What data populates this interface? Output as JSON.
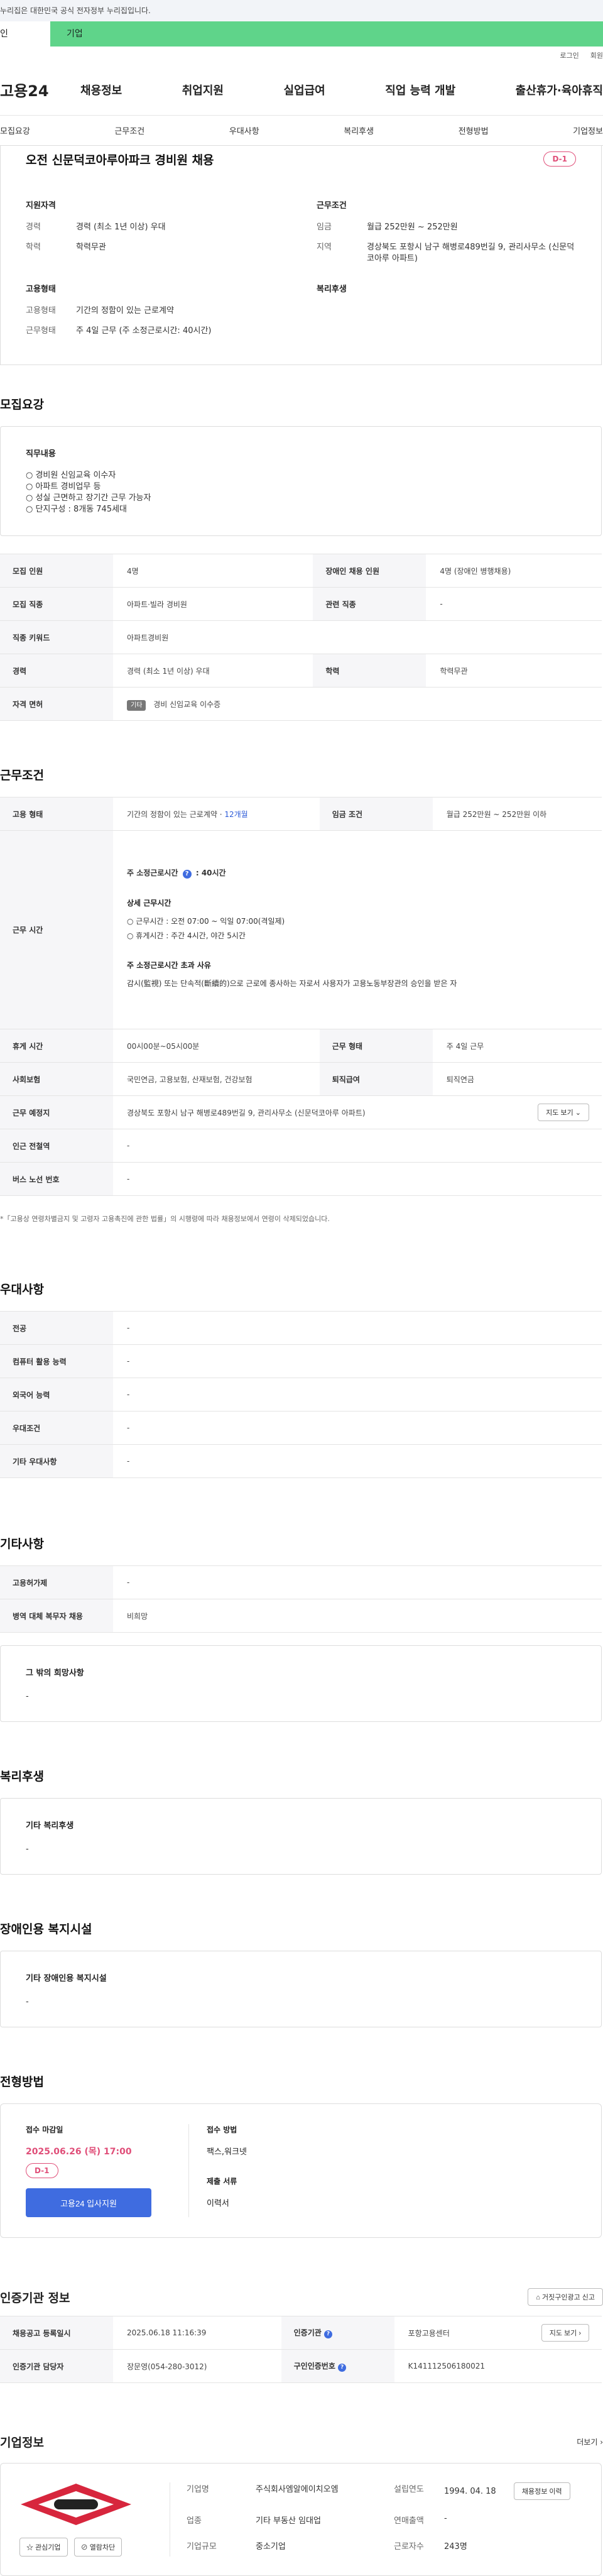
{
  "banner": {
    "text": "누리집은 대한민국 공식 전자정부 누리집입니다."
  },
  "tabs": {
    "personal": "인",
    "company": "기업"
  },
  "util": {
    "login": "로그인",
    "signup": "회원"
  },
  "gnb": {
    "logo": "고용24",
    "menu": [
      "채용정보",
      "취업지원",
      "실업급여",
      "직업 능력 개발",
      "출산휴가·육아휴직"
    ]
  },
  "subnav": [
    "모집요강",
    "근무조건",
    "우대사항",
    "복리후생",
    "전형방법",
    "기업정보"
  ],
  "summary": {
    "title": "오전 신문덕코아루아파크 경비원 채용",
    "dday": "D-1",
    "qualification": {
      "heading": "지원자격",
      "career_k": "경력",
      "career_v": "경력 (최소 1년 이상) 우대",
      "edu_k": "학력",
      "edu_v": "학력무관"
    },
    "conditions": {
      "heading": "근무조건",
      "wage_k": "임금",
      "wage_v": "월급 252만원 ~ 252만원",
      "region_k": "지역",
      "region_v": "경상북도 포항시 남구 해병로489번길 9, 관리사무소 (신문덕코아루 아파트)"
    },
    "employment": {
      "heading": "고용형태",
      "type_k": "고용형태",
      "type_v": "기간의 정함이 있는 근로계약",
      "work_k": "근무형태",
      "work_v": "주 4일 근무 (주 소정근로시간: 40시간)"
    },
    "welfare": {
      "heading": "복리후생"
    }
  },
  "recruit": {
    "title": "모집요강",
    "job_content_heading": "직무내용",
    "job_lines": [
      "○ 경비원 신임교육 이수자",
      "○ 아파트 경비업무 등",
      "○ 성실 근면하고 장기간 근무 가능자",
      "○ 단지구성 : 8개동 745세대"
    ],
    "table": {
      "headcount_k": "모집 인원",
      "headcount_v": "4명",
      "disabled_k": "장애인 채용 인원",
      "disabled_v": "4명 (장애인 병행채용)",
      "field_k": "모집 직종",
      "field_v": "아파트·빌라 경비원",
      "related_k": "관련 직종",
      "related_v": "-",
      "keyword_k": "직종 키워드",
      "keyword_v": "아파트경비원",
      "career_k": "경력",
      "career_v": "경력 (최소 1년 이상) 우대",
      "edu_k": "학력",
      "edu_v": "학력무관",
      "license_k": "자격 면허",
      "license_tag": "기타",
      "license_v": "경비 신임교육 이수증"
    }
  },
  "work": {
    "title": "근무조건",
    "emp_type_k": "고용 형태",
    "emp_type_v": "기간의 정함이 있는 근로계약 · ",
    "emp_type_period": "12개월",
    "wage_k": "임금 조건",
    "wage_v": "월급 252만원 ~ 252만원 이하",
    "hours_k": "근무 시간",
    "weekly_label": "주 소정근로시간",
    "weekly_value": ": 40시간",
    "detail_heading": "상세 근무시간",
    "detail_lines": [
      "○ 근무시간 : 오전 07:00 ~ 익일 07:00(격일제)",
      "○ 휴게시간 : 주간 4시간, 야간 5시간"
    ],
    "over_heading": "주 소정근로시간 초과 사유",
    "over_text": "감시(監視) 또는 단속적(斷續的)으로 근로에 종사하는 자로서 사용자가 고용노동부장관의 승인을 받은 자",
    "break_k": "휴게 시간",
    "break_v": "00시00분~05시00분",
    "form_k": "근무 형태",
    "form_v": "주 4일 근무",
    "insurance_k": "사회보험",
    "insurance_v": "국민연금, 고용보험, 산재보험, 건강보험",
    "retire_k": "퇴직급여",
    "retire_v": "퇴직연금",
    "place_k": "근무 예정지",
    "place_v": "경상북도 포항시 남구 해병로489번길 9, 관리사무소 (신문덕코아루 아파트)",
    "map_btn": "지도 보기",
    "subway_k": "인근 전철역",
    "subway_v": "-",
    "bus_k": "버스 노선 번호",
    "bus_v": "-",
    "footnote": "*「고용상 연령차별금지 및 고령자 고용촉진에 관한 법률」의 시행령에 따라 채용정보에서 연령이 삭제되었습니다."
  },
  "preference": {
    "title": "우대사항",
    "rows": [
      {
        "k": "전공",
        "v": "-"
      },
      {
        "k": "컴퓨터 활용 능력",
        "v": "-"
      },
      {
        "k": "외국어 능력",
        "v": "-"
      },
      {
        "k": "우대조건",
        "v": "-"
      },
      {
        "k": "기타 우대사항",
        "v": "-"
      }
    ]
  },
  "others": {
    "title": "기타사항",
    "rows": [
      {
        "k": "고용허가제",
        "v": "-"
      },
      {
        "k": "병역 대체 복무자 채용",
        "v": "비희망"
      }
    ],
    "wish_heading": "그 밖의 희망사항",
    "wish_value": "-"
  },
  "welfare": {
    "title": "복리후생",
    "heading": "기타 복리후생",
    "value": "-"
  },
  "disability": {
    "title": "장애인용 복지시설",
    "heading": "기타 장애인용 복지시설",
    "value": "-"
  },
  "selection": {
    "title": "전형방법",
    "deadline_heading": "접수 마감일",
    "deadline": "2025.06.26 (목) 17:00",
    "dday": "D-1",
    "apply_btn": "고용24 입사지원",
    "method_heading": "접수 방법",
    "method_value": "팩스,워크넷",
    "docs_heading": "제출 서류",
    "docs_value": "이력서"
  },
  "agency": {
    "title": "인증기관 정보",
    "report_btn": "거짓구인광고 신고",
    "reg_date_k": "채용공고 등록일시",
    "reg_date_v": "2025.06.18 11:16:39",
    "agency_k": "인증기관",
    "agency_v": "포항고용센터",
    "map_btn": "지도 보기",
    "manager_k": "인증기관 담당자",
    "manager_v": "장문영(054-280-3012)",
    "reqno_k": "구인인증번호",
    "reqno_v": "K141112506180021"
  },
  "company": {
    "title": "기업정보",
    "more": "더보기",
    "interest_btn": "관심기업",
    "block_btn": "열람차단",
    "name_k": "기업명",
    "name_v": "주식회사엠알에이치오엠",
    "founded_k": "설립연도",
    "founded_v": "1994. 04. 18",
    "history_btn": "채용정보 이력",
    "industry_k": "업종",
    "industry_v": "기타 부동산 임대업",
    "sales_k": "연매출액",
    "sales_v": "-",
    "employees_k": "근로자수",
    "employees_v": "243명",
    "size_k": "기업규모",
    "size_v": "중소기업"
  }
}
